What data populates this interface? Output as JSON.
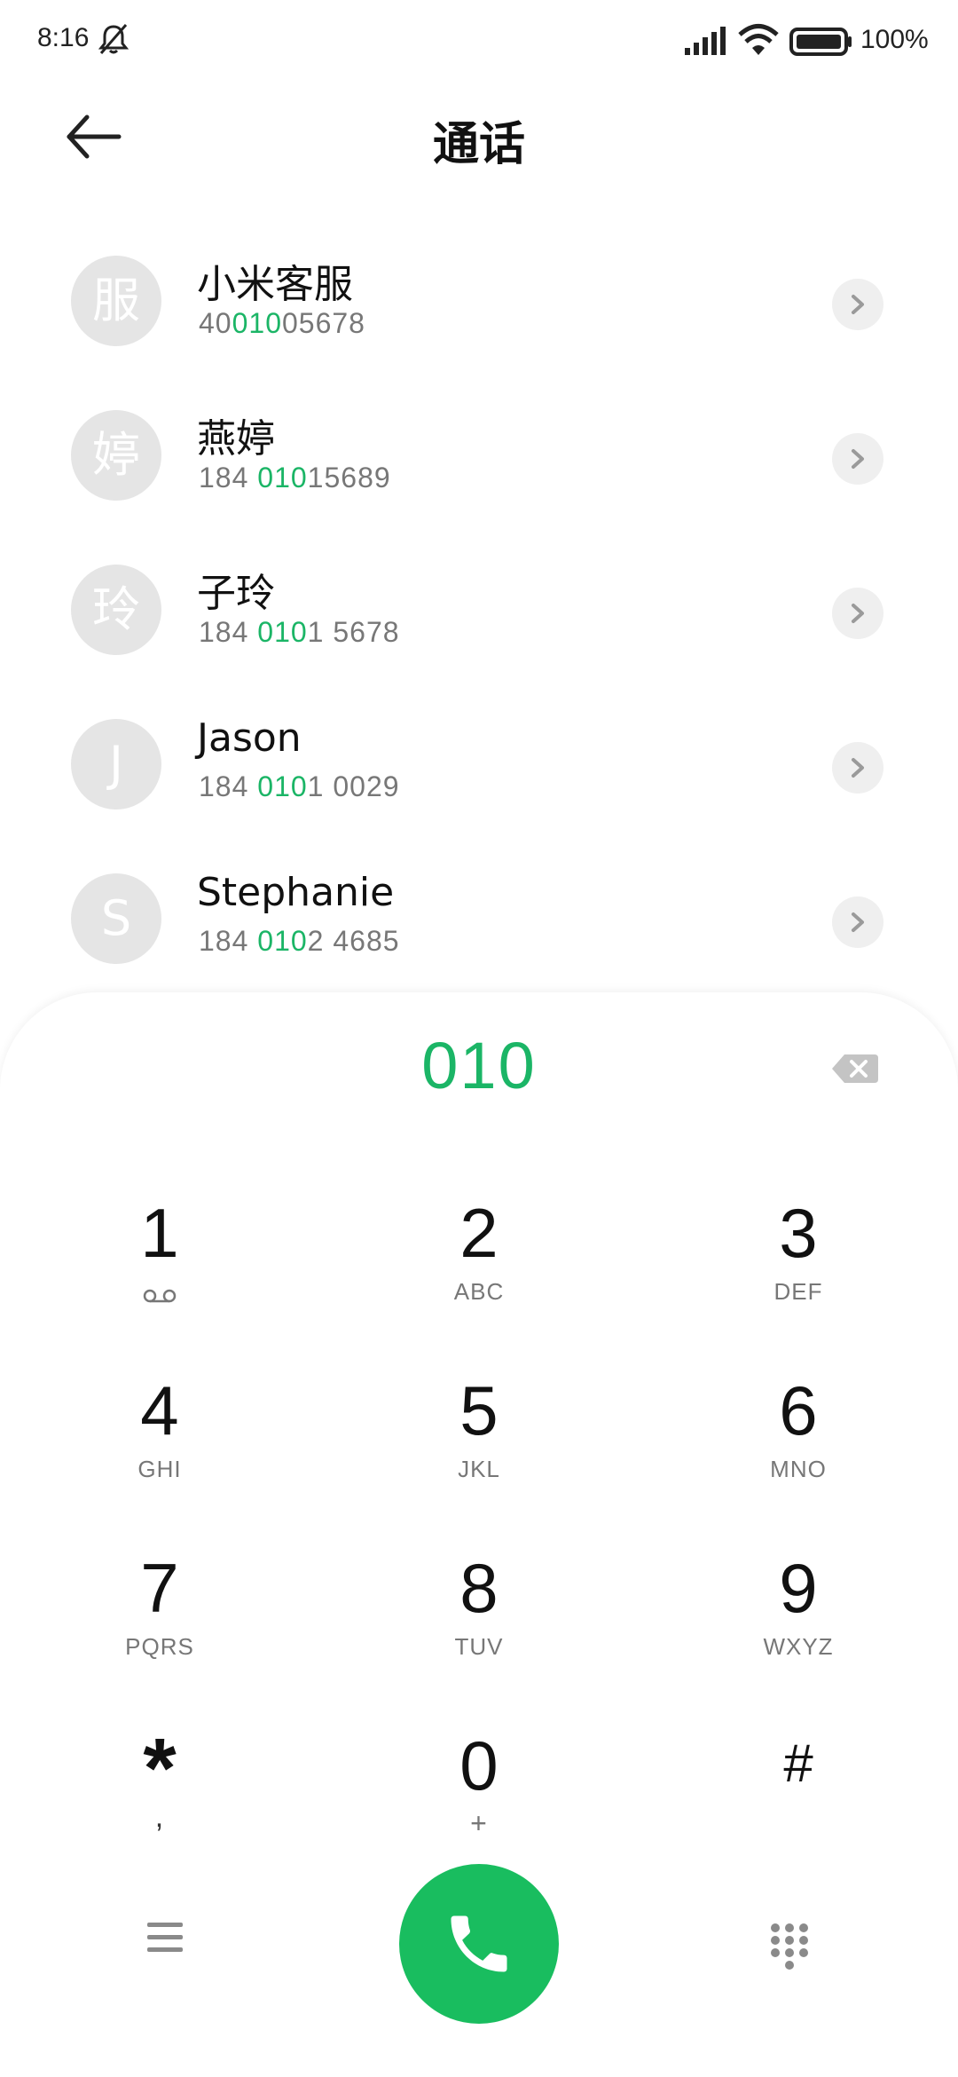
{
  "status_bar": {
    "time": "8:16",
    "battery_percent": "100%",
    "icons": [
      "bell-off-icon",
      "signal-icon",
      "wifi-icon",
      "battery-icon"
    ]
  },
  "header": {
    "title": "通话",
    "back_icon": "arrow-left-icon"
  },
  "contacts": [
    {
      "initial": "服",
      "name": "小米客服",
      "num_pre": "40",
      "num_match": "010",
      "num_post": "05678"
    },
    {
      "initial": "婷",
      "name": "燕婷",
      "num_pre": "184 ",
      "num_match": "010",
      "num_post": "15689"
    },
    {
      "initial": "玲",
      "name": "子玲",
      "num_pre": "184 ",
      "num_match": "010",
      "num_post": "1 5678"
    },
    {
      "initial": "J",
      "name": "Jason",
      "num_pre": "184 ",
      "num_match": "010",
      "num_post": "1 0029"
    },
    {
      "initial": "S",
      "name": "Stephanie",
      "num_pre": "184 ",
      "num_match": "010",
      "num_post": "2 4685"
    }
  ],
  "dialer": {
    "input": "010",
    "keys": [
      {
        "digit": "1",
        "letters": ""
      },
      {
        "digit": "2",
        "letters": "ABC"
      },
      {
        "digit": "3",
        "letters": "DEF"
      },
      {
        "digit": "4",
        "letters": "GHI"
      },
      {
        "digit": "5",
        "letters": "JKL"
      },
      {
        "digit": "6",
        "letters": "MNO"
      },
      {
        "digit": "7",
        "letters": "PQRS"
      },
      {
        "digit": "8",
        "letters": "TUV"
      },
      {
        "digit": "9",
        "letters": "WXYZ"
      },
      {
        "digit": "*",
        "letters": ","
      },
      {
        "digit": "0",
        "letters": "+"
      },
      {
        "digit": "#",
        "letters": ""
      }
    ]
  },
  "colors": {
    "accent": "#1bb566",
    "call_button": "#19bd5f",
    "avatar_bg": "#e5e5e5"
  }
}
